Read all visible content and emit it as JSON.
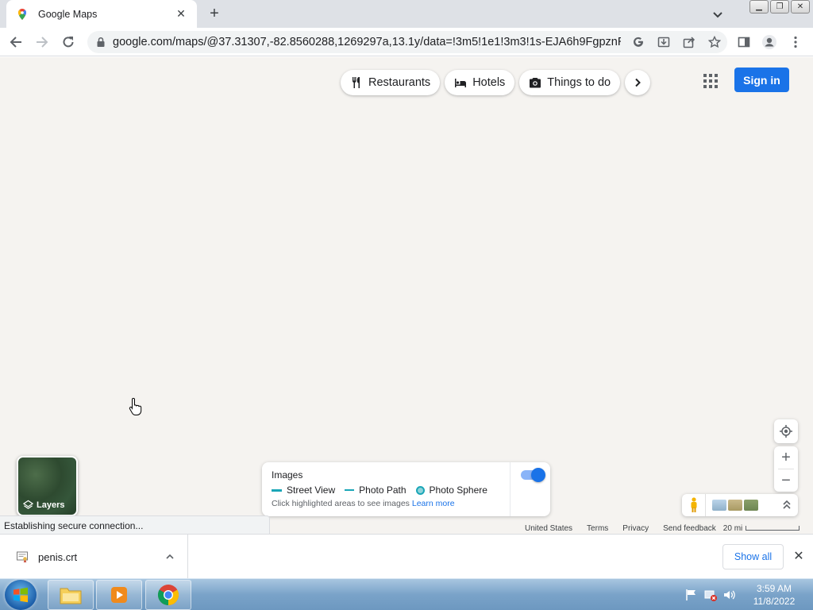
{
  "browser": {
    "tab_title": "Google Maps",
    "url": "google.com/maps/@37.31307,-82.8560288,1269297a,13.1y/data=!3m5!1e1!3m3!1s-EJA6h9FgpznRP4..."
  },
  "map": {
    "chips": [
      {
        "label": "Restaurants",
        "icon": "fork-knife-icon"
      },
      {
        "label": "Hotels",
        "icon": "bed-icon"
      },
      {
        "label": "Things to do",
        "icon": "camera-icon"
      }
    ],
    "sign_in_label": "Sign in",
    "layers_label": "Layers",
    "images_panel": {
      "title": "Images",
      "legend": [
        "Street View",
        "Photo Path",
        "Photo Sphere"
      ],
      "hint": "Click highlighted areas to see images",
      "learn_more": "Learn more",
      "toggle_on": true
    },
    "footer": {
      "country": "United States",
      "terms": "Terms",
      "privacy": "Privacy",
      "feedback": "Send feedback",
      "scale": "20 mi"
    },
    "status_text": "Establishing secure connection..."
  },
  "downloads": {
    "file_name": "penis.crt",
    "show_all": "Show all"
  },
  "taskbar": {
    "time": "3:59 AM",
    "date": "11/8/2022"
  },
  "colors": {
    "accent": "#1a73e8",
    "map_bg": "#f5f3f0",
    "street_view": "#1aa6b7"
  }
}
